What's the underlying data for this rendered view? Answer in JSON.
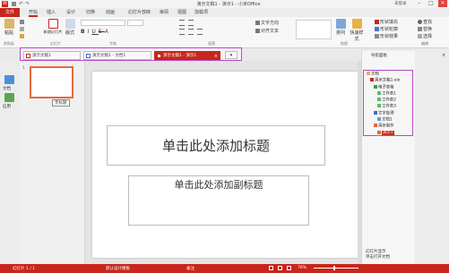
{
  "window": {
    "title": "演示文稿1 - 演示1 - 小米Office",
    "logo": "W",
    "user": "未登录"
  },
  "menu": {
    "file": "文件",
    "items": [
      "开始",
      "插入",
      "设计",
      "切换",
      "动画",
      "幻灯片放映",
      "审阅",
      "视图",
      "加载项"
    ]
  },
  "ribbon": {
    "paste": "粘贴",
    "new_slide": "新建幻灯片",
    "layout": "版式",
    "format_painter": "格式刷",
    "text_direction": "文字方向",
    "align_text": "对齐文本",
    "convert_smartart": "转换为SmartArt",
    "shape_fill": "形状填充",
    "shape_outline": "形状轮廓",
    "shape_effects": "形状效果",
    "quick_styles": "快速样式",
    "arrange": "排列",
    "find": "查找",
    "replace": "替换",
    "select": "选择"
  },
  "groups": {
    "clipboard": "剪贴板",
    "slides": "幻灯片",
    "font": "字体",
    "paragraph": "段落",
    "drawing": "绘图",
    "editing": "编辑"
  },
  "doc_tabs": [
    "演示文稿1",
    "演示文稿1 - 文档1",
    "演示文稿1 - 演示1"
  ],
  "left_panel": {
    "label_docs": "文档",
    "label_app": "应用"
  },
  "thumbnail": {
    "number": "1",
    "tooltip": "无标题"
  },
  "slide": {
    "title_placeholder": "单击此处添加标题",
    "subtitle_placeholder": "单击此处添加副标题"
  },
  "nav": {
    "header": "导航面板",
    "items": [
      {
        "label": "文档",
        "level": 0
      },
      {
        "label": "演示文稿1.elo",
        "level": 1
      },
      {
        "label": "电子表格",
        "level": 2
      },
      {
        "label": "工作表1",
        "level": 3
      },
      {
        "label": "工作表2",
        "level": 3
      },
      {
        "label": "工作表3",
        "level": 3
      },
      {
        "label": "文字处理",
        "level": 2
      },
      {
        "label": "文档1",
        "level": 3
      },
      {
        "label": "演示制作",
        "level": 2
      },
      {
        "label": "演示1",
        "level": 3
      }
    ],
    "footer1": "导航面板",
    "footer2": "幻灯片显示",
    "footer3": "单击打开文档"
  },
  "status": {
    "slide_count": "幻灯片 1 / 1",
    "theme": "默认设计模板",
    "notes": "备注",
    "zoom": "76%"
  },
  "colors": {
    "accent": "#c8261b",
    "highlight_box": "#ba46c8",
    "thumb_border": "#e8683e"
  }
}
